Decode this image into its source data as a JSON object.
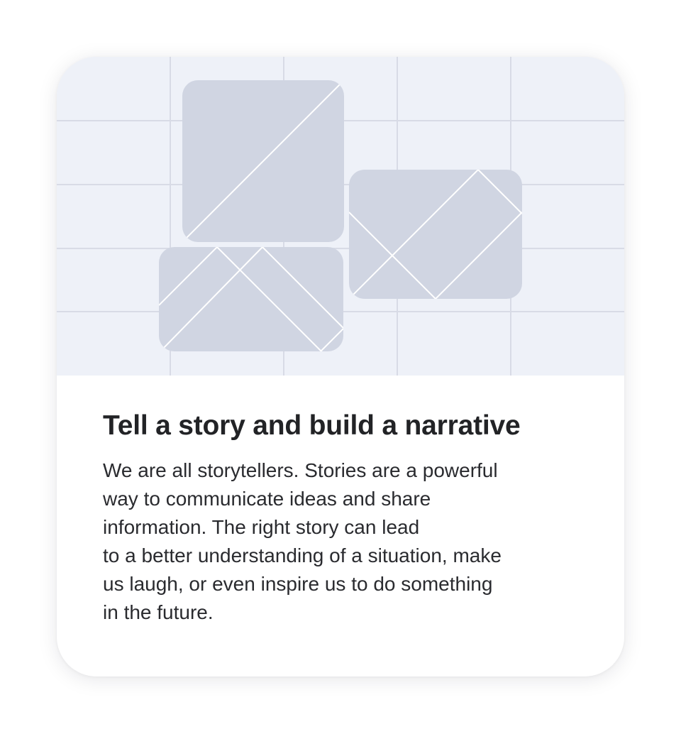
{
  "card": {
    "title": "Tell a story and build a narrative",
    "body": "We are all storytellers. Stories are a powerful\nway to communicate ideas and share\ninformation. The right story can lead\nto a better understanding of a situation, make\nus laugh, or even inspire us to do something\nin the future."
  },
  "illustration": {
    "icon": "image-placeholder-icon",
    "colors": {
      "background": "#eef1f8",
      "grid": "#d8dbe6",
      "tile": "#d0d5e2",
      "tile_lines": "#ffffff"
    }
  }
}
